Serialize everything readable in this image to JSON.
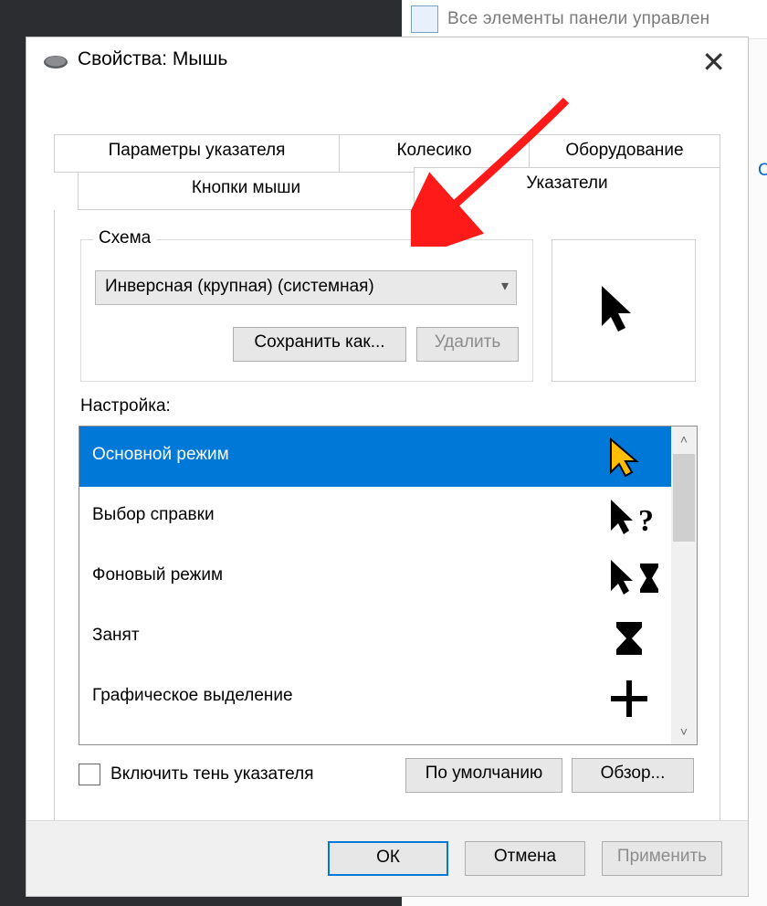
{
  "bg": {
    "breadcrumb_text": "Все элементы панели управлен",
    "frag_char": "С"
  },
  "dialog": {
    "title": "Свойства: Мышь",
    "tabs": {
      "top": [
        "Параметры указателя",
        "Колесико",
        "Оборудование"
      ],
      "bottom": [
        "Кнопки мыши",
        "Указатели"
      ]
    },
    "scheme": {
      "legend": "Схема",
      "selected": "Инверсная (крупная) (системная)",
      "save_as": "Сохранить как...",
      "delete": "Удалить"
    },
    "custom_label": "Настройка:",
    "list": [
      {
        "label": "Основной режим",
        "icon": "arrow-sel"
      },
      {
        "label": "Выбор справки",
        "icon": "arrow-help"
      },
      {
        "label": "Фоновый режим",
        "icon": "arrow-hourglass"
      },
      {
        "label": "Занят",
        "icon": "hourglass"
      },
      {
        "label": "Графическое выделение",
        "icon": "cross"
      }
    ],
    "checkbox_label": "Включить тень указателя",
    "btn_defaults": "По умолчанию",
    "btn_browse": "Обзор...",
    "btn_ok": "ОК",
    "btn_cancel": "Отмена",
    "btn_apply": "Применить"
  }
}
